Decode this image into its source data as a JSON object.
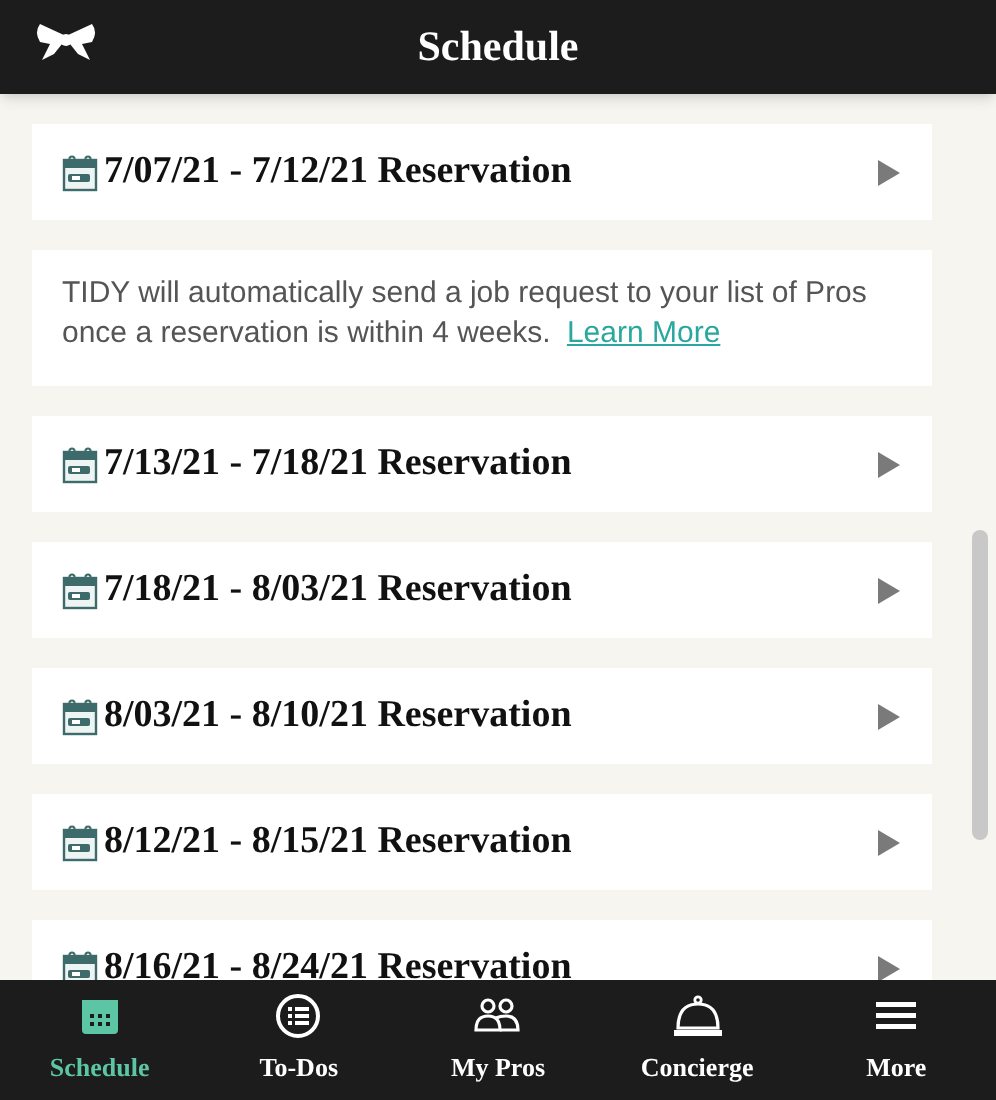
{
  "header": {
    "title": "Schedule"
  },
  "items": [
    {
      "kind": "reservation",
      "label": "7/07/21 - 7/12/21 Reservation"
    },
    {
      "kind": "notice",
      "text": "TIDY will automatically send a job request to your list of Pros once a reservation is within 4 weeks.",
      "link": "Learn More"
    },
    {
      "kind": "reservation",
      "label": "7/13/21 - 7/18/21 Reservation"
    },
    {
      "kind": "reservation",
      "label": "7/18/21 - 8/03/21 Reservation"
    },
    {
      "kind": "reservation",
      "label": "8/03/21 - 8/10/21 Reservation"
    },
    {
      "kind": "reservation",
      "label": "8/12/21 - 8/15/21 Reservation"
    },
    {
      "kind": "reservation",
      "label": "8/16/21 - 8/24/21 Reservation"
    }
  ],
  "tabs": [
    {
      "kind": "calendar",
      "label": "Schedule",
      "selected": true
    },
    {
      "kind": "list",
      "label": "To-Dos",
      "selected": false
    },
    {
      "kind": "people",
      "label": "My Pros",
      "selected": false
    },
    {
      "kind": "bell",
      "label": "Concierge",
      "selected": false
    },
    {
      "kind": "menu",
      "label": "More",
      "selected": false
    }
  ]
}
